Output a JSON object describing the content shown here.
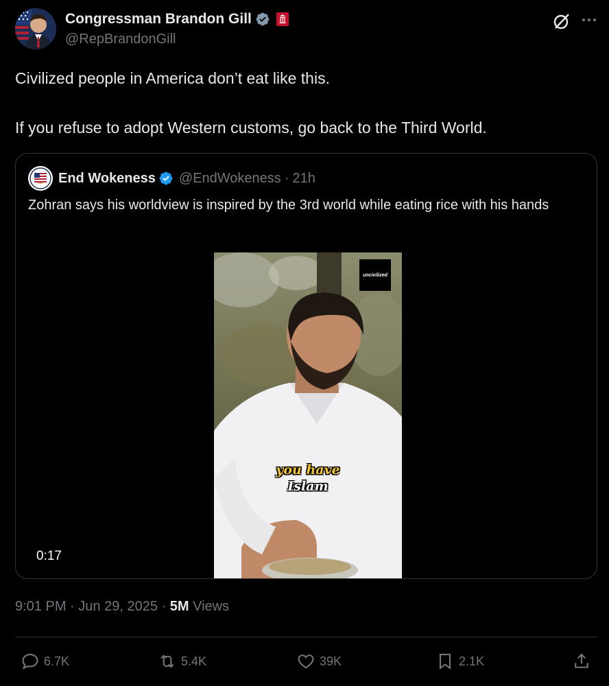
{
  "author": {
    "display_name": "Congressman Brandon Gill",
    "handle": "@RepBrandonGill"
  },
  "tweet": {
    "line1": "Civilized people in America don’t eat like this.",
    "line2": "If you refuse to adopt Western customs, go back to the Third World."
  },
  "quoted": {
    "display_name": "End Wokeness",
    "handle": "@EndWokeness",
    "separator": "·",
    "time": "21h",
    "text": "Zohran says his worldview is inspired by the 3rd world while eating rice with his hands",
    "video": {
      "watermark": "uncivilized",
      "caption_line1": "you have",
      "caption_line2": "Islam",
      "duration": "0:17"
    }
  },
  "meta": {
    "time": "9:01 PM",
    "sep1": "·",
    "date": "Jun 29, 2025",
    "sep2": "·",
    "views_count": "5M",
    "views_label": "Views"
  },
  "actions": {
    "replies": "6.7K",
    "reposts": "5.4K",
    "likes": "39K",
    "bookmarks": "2.1K"
  },
  "colors": {
    "background": "#000000",
    "text_primary": "#e7e9ea",
    "text_secondary": "#71767b",
    "verified_blue": "#1d9bf0",
    "border": "#333639",
    "caption_yellow": "#f3c531"
  },
  "icons": [
    "verified-badge-icon",
    "government-badge-icon",
    "grok-icon",
    "more-icon",
    "reply-icon",
    "repost-icon",
    "like-icon",
    "bookmark-icon",
    "share-icon"
  ]
}
